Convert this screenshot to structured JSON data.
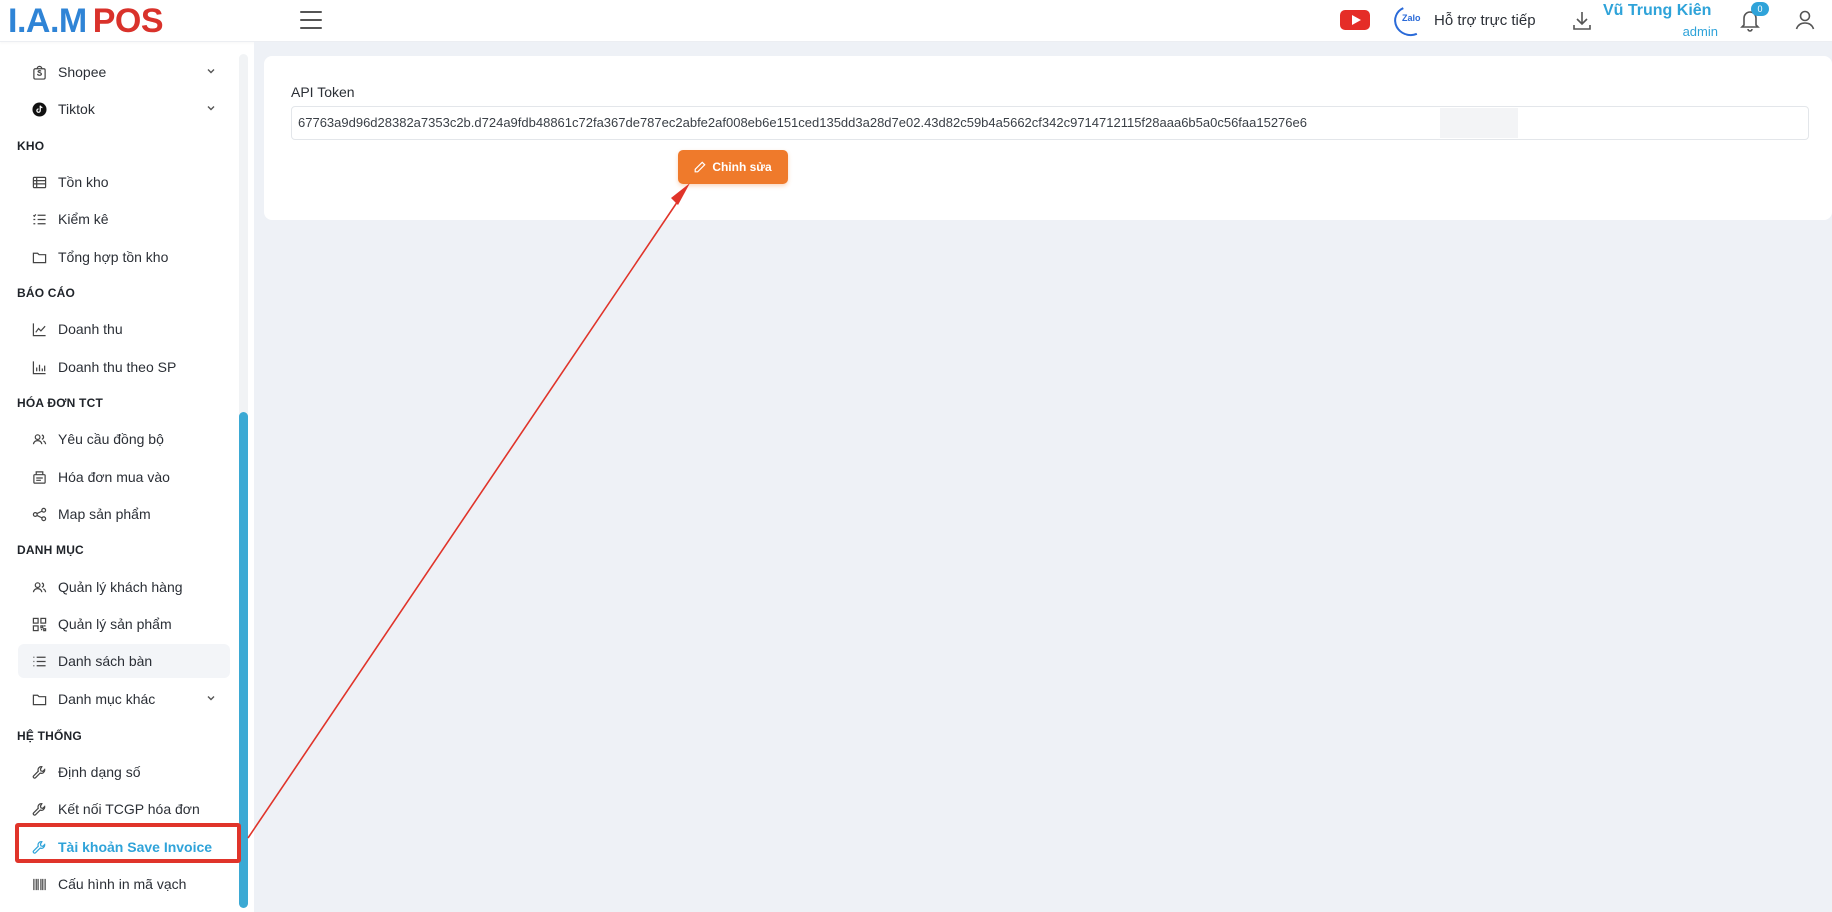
{
  "header": {
    "logo_part1": "I.A.M",
    "logo_part2": "POS",
    "zalo_label": "Zalo",
    "support_label": "Hỗ trợ trực tiếp",
    "user_name": "Vũ Trung Kiên",
    "user_role": "admin",
    "notification_count": "0"
  },
  "sidebar": {
    "items_top": [
      {
        "label": "Shopee",
        "icon": "shopee-icon"
      },
      {
        "label": "Tiktok",
        "icon": "tiktok-icon"
      }
    ],
    "sections": [
      {
        "title": "KHO",
        "items": [
          "Tồn kho",
          "Kiểm kê",
          "Tổng hợp tồn kho"
        ]
      },
      {
        "title": "BÁO CÁO",
        "items": [
          "Doanh thu",
          "Doanh thu theo SP"
        ]
      },
      {
        "title": "HÓA ĐƠN TCT",
        "items": [
          "Yêu cầu đồng bộ",
          "Hóa đơn mua vào",
          "Map sản phẩm"
        ]
      },
      {
        "title": "DANH MỤC",
        "items": [
          "Quản lý khách hàng",
          "Quản lý sản phẩm",
          "Danh sách bàn",
          "Danh mục khác"
        ]
      },
      {
        "title": "HỆ THỐNG",
        "items": [
          "Định dạng số",
          "Kết nối TCGP hóa đơn",
          "Tài khoản Save Invoice",
          "Cấu hình in mã vạch"
        ]
      }
    ]
  },
  "main": {
    "token_label": "API Token",
    "token_value": "67763a9d96d28382a7353c2b.d724a9fdb48861c72fa367de787ec2abfe2af008eb6e151ced135dd3a28d7e02.43d82c59b4a5662cf342c9714712115f28aaa6b5a0c56faa15276e6",
    "edit_label": "Chỉnh sửa"
  },
  "colors": {
    "accent": "#2fa3d9",
    "button": "#ef7a2b",
    "highlight": "#e0342a",
    "logo_blue": "#2f84d6",
    "logo_red": "#d9322b"
  }
}
